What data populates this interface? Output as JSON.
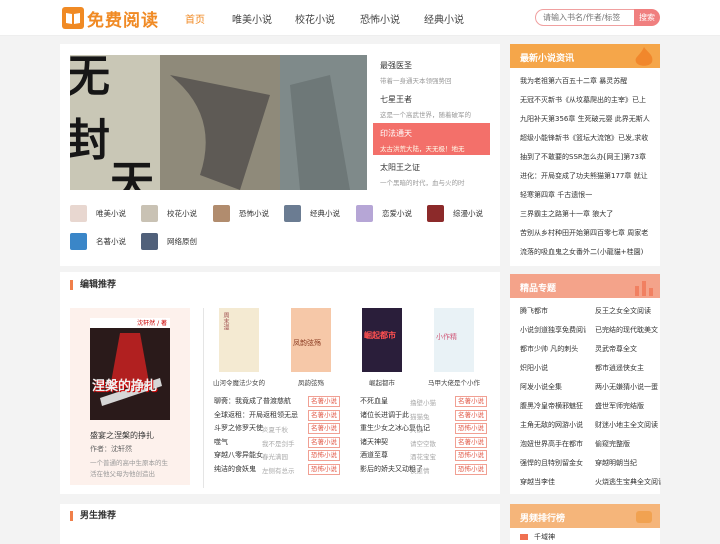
{
  "header": {
    "logo_text": "免费阅读",
    "nav": [
      "首页",
      "唯美小说",
      "校花小说",
      "恐怖小说",
      "经典小说"
    ],
    "search_placeholder": "请输入书名/作者/标签",
    "search_button": "搜索"
  },
  "banner": {
    "items": [
      {
        "title": "最强医圣",
        "desc": "带着一身通天本领强势回"
      },
      {
        "title": "七星王者",
        "desc": "这是一个高武世界，随着破军的"
      },
      {
        "title": "印法通天",
        "desc": "太古洪荒大陆，天无极！地无"
      },
      {
        "title": "太阳王之证",
        "desc": "一个黑暗的时代，血与火的时"
      }
    ]
  },
  "categories": [
    "唯美小说",
    "校花小说",
    "恐怖小说",
    "经典小说",
    "恋爱小说",
    "综漫小说",
    "名著小说",
    "网络原创"
  ],
  "editor": {
    "title": "编辑推荐",
    "featured": {
      "title": "盛宴之涅槃的挣扎",
      "author": "作者：沈轩然",
      "desc": "一个普通的高中生原本的生活在他父母为他创造出",
      "cover_text": "涅槃的挣扎",
      "cover_top": "沈轩然 / 著"
    },
    "books": [
      {
        "title": "山河令魔法少女的",
        "cover": "周末漫"
      },
      {
        "title": "凤韵弦殇",
        "cover": "凤韵弦殇"
      },
      {
        "title": "崛起都市",
        "cover": "崛起都市"
      },
      {
        "title": "马甲大佬是个小作",
        "cover": "小作精"
      }
    ],
    "rows_left": [
      {
        "name": "聊斋：我竟成了普渡慈航",
        "author": "",
        "tag": "名著小说"
      },
      {
        "name": "全球返租：开局返租领无忌",
        "author": "",
        "tag": "名著小说"
      },
      {
        "name": "斗罗之修罗天使",
        "author": "炎夏千秋",
        "tag": "名著小说"
      },
      {
        "name": "噬气",
        "author": "我不是剑手",
        "tag": "名著小说"
      },
      {
        "name": "穿越八零异能女",
        "author": "春光满园",
        "tag": "恐怖小说"
      },
      {
        "name": "纯洁的食妖鬼",
        "author": "左侧有总示",
        "tag": "恐怖小说"
      }
    ],
    "rows_right": [
      {
        "name": "不死血皇",
        "author": "撸壁小猫",
        "tag": "名著小说"
      },
      {
        "name": "诸位长进调于此",
        "author": "猫猫兔",
        "tag": "名著小说"
      },
      {
        "name": "重生少女之冰心复仇记",
        "author": "大漠",
        "tag": "恐怖小说"
      },
      {
        "name": "诸天神契",
        "author": "请空空散",
        "tag": "名著小说"
      },
      {
        "name": "酒道至尊",
        "author": "酒花宝宝",
        "tag": "恐怖小说"
      },
      {
        "name": "影后的娇夫又动粗了",
        "author": "仅愿情",
        "tag": "恐怖小说"
      }
    ]
  },
  "male": {
    "title": "男生推荐"
  },
  "news": {
    "title": "最新小说资讯",
    "items": [
      "我为老祖第六百五十二章 暴灵苏醒",
      "无冠不灭新书《从坟墓爬出的主宰》已上",
      "九阳补天第356章 生死破元婴 此界无斯人",
      "超级小能锋新书《篮坛大流馆》已发,求收",
      "抽到了不敢要的SSR怎么办[网王]第73章",
      "进化：开局变成了功夫熊猫第177章 就让",
      "轻寒第四章 千古遗恨一",
      "三界霸主之路第十一章 狼大了",
      "苦别从乡村种田开始第四百零七章 周家老",
      "流落的吸血鬼之女番外二(小龍貓+桂園)"
    ]
  },
  "topics": {
    "title": "精品专题",
    "left": [
      "腾飞都市",
      "小说剑道独享免费阅读",
      "都市少帅 凡的刺头",
      "炽阳小说",
      "阿发小说全集",
      "腹黑冷皇帝横邪魅狂",
      "主角无敌的网游小说",
      "泡妞世界高手在都市",
      "强悍的且特别留金女",
      "穿越当李佳"
    ],
    "right": [
      "反王之女全文阅读",
      "已完结的现代耽美文",
      "灵武帝尊全文",
      "都市逍遥侠女主",
      "两小无嫌猜小说一蛋",
      "盛世军师完结版",
      "财迷小地主全文阅读",
      "偷窥完整版",
      "穿越明朝当纪",
      "火烧逃生宝典全文阅读"
    ]
  },
  "rank": {
    "title": "男频排行榜",
    "first": "千域神"
  }
}
